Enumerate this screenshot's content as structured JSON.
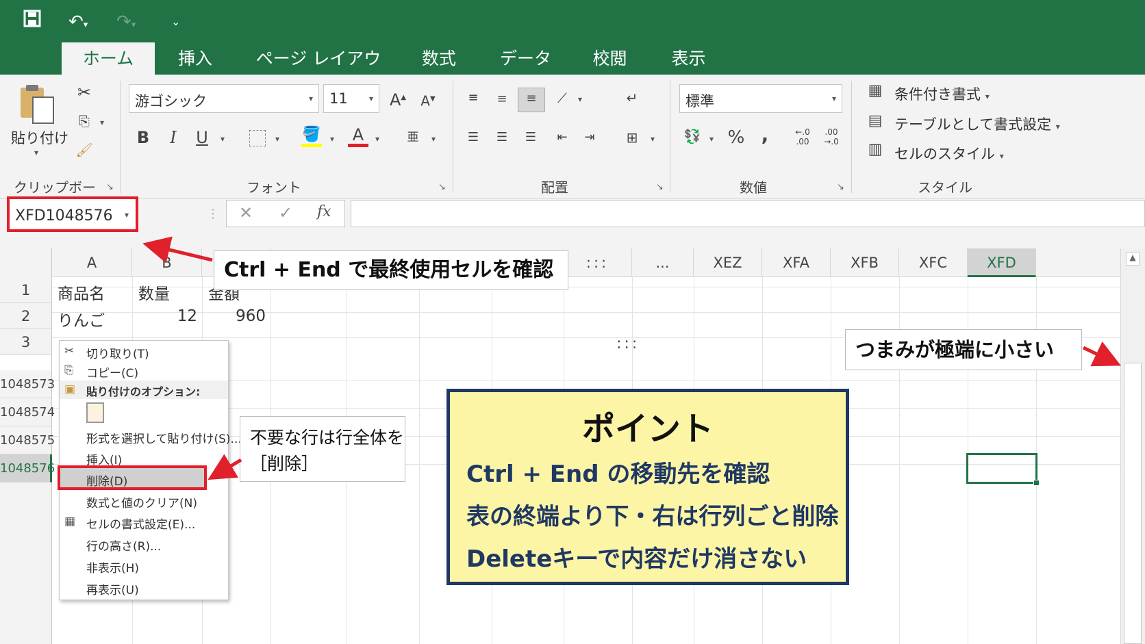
{
  "quick_access": {
    "save_icon": "save-icon",
    "undo_icon": "undo-icon",
    "redo_icon": "redo-icon",
    "customize_icon": "customize-icon"
  },
  "tabs": [
    "ホーム",
    "挿入",
    "ページ レイアウト",
    "数式",
    "データ",
    "校閲",
    "表示"
  ],
  "clipboard": {
    "paste_label": "貼り付け",
    "group_label": "クリップボード"
  },
  "font": {
    "name": "游ゴシック",
    "size": "11",
    "bold": "B",
    "italic": "I",
    "underline": "U",
    "color_letter": "A",
    "phonetic": "亜",
    "group_label": "フォント"
  },
  "alignment": {
    "group_label": "配置"
  },
  "number": {
    "format": "標準",
    "percent": "%",
    "comma": ",",
    "group_label": "数値"
  },
  "styles": {
    "conditional": "条件付き書式",
    "table": "テーブルとして書式設定",
    "cell_styles": "セルのスタイル",
    "group_label": "スタイル"
  },
  "formula_bar": {
    "name_box": "XFD1048576",
    "cancel": "✕",
    "enter": "✓",
    "fx": "fx"
  },
  "columns_left": [
    "A",
    "B"
  ],
  "columns_right": [
    ":::",
    "...",
    "XEZ",
    "XFA",
    "XFB",
    "XFC",
    "XFD"
  ],
  "rows": [
    "1",
    "2",
    "3",
    "1048573",
    "1048574",
    "1048575",
    "1048576"
  ],
  "cells": {
    "A1": "商品名",
    "B1": "数量",
    "C1": "金額",
    "A2": "りんご",
    "B2": "12",
    "C2": "960"
  },
  "ellipsis_mid": ":::",
  "context_menu": {
    "items": [
      "切り取り(T)",
      "コピー(C)",
      "貼り付けのオプション:",
      "形式を選択して貼り付け(S)...",
      "挿入(I)",
      "削除(D)",
      "数式と値のクリア(N)",
      "セルの書式設定(E)...",
      "行の高さ(R)...",
      "非表示(H)",
      "再表示(U)"
    ]
  },
  "callouts": {
    "ctrl_end": "Ctrl + End で最終使用セルを確認",
    "delete_row_line1": "不要な行は行全体を",
    "delete_row_line2": "［削除］",
    "scroll_thumb": "つまみが極端に小さい"
  },
  "point_box": {
    "title": "ポイント",
    "line1": "Ctrl + End の移動先を確認",
    "line2": "表の終端より下・右は行列ごと削除",
    "line3": "Deleteキーで内容だけ消さない"
  },
  "colors": {
    "excel_green": "#217346",
    "highlight_red": "#e0202a",
    "point_bg": "#fdf5a6",
    "point_border": "#1f3864"
  }
}
